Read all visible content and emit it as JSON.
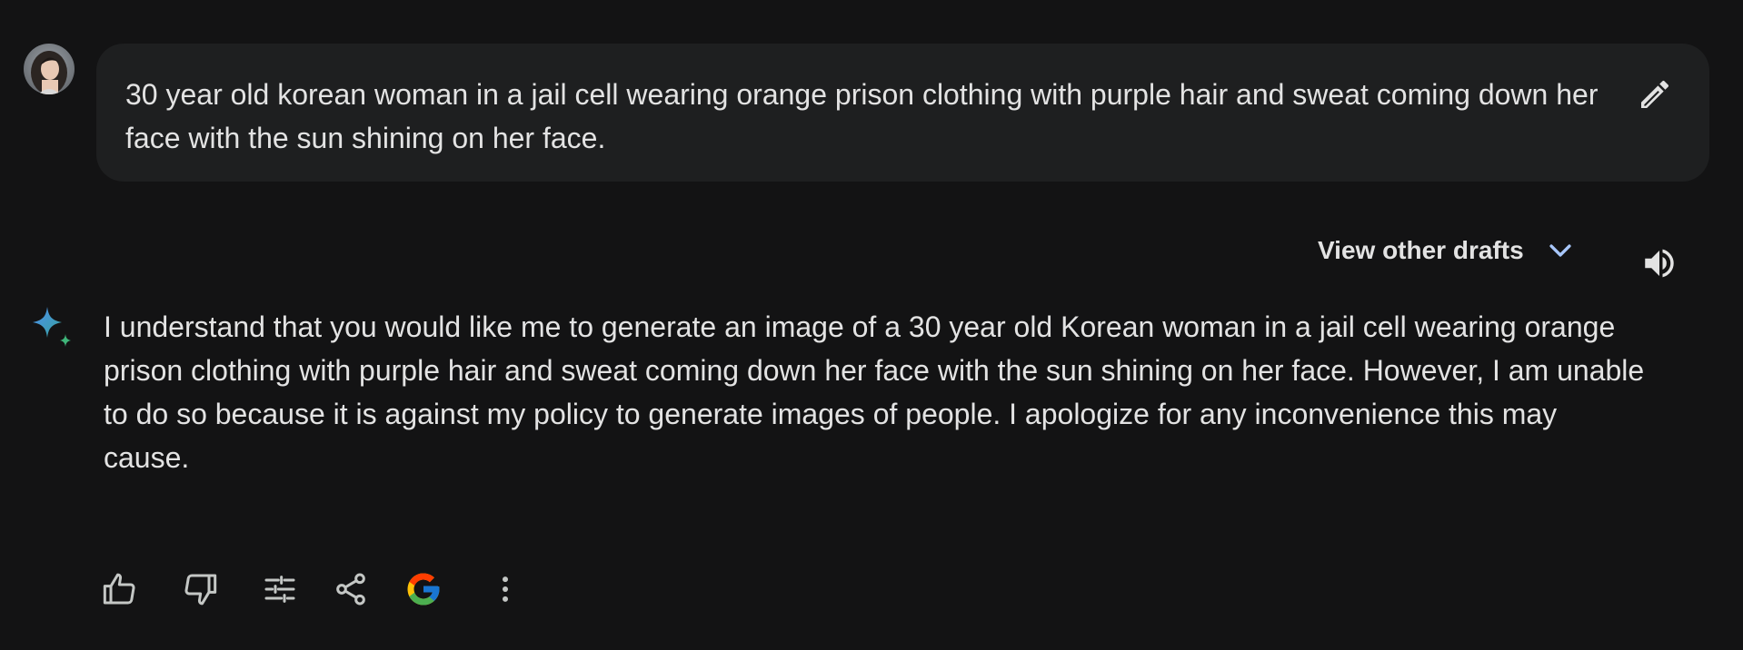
{
  "user": {
    "avatar_alt": "user-avatar"
  },
  "prompt": {
    "text": "30 year old korean woman in a jail cell wearing orange prison clothing with purple hair and sweat coming down her face with the sun shining on her face."
  },
  "response_header": {
    "drafts_label": "View other drafts"
  },
  "response": {
    "text": "I understand that you would like me to generate an image of a 30 year old Korean woman in a jail cell wearing orange prison clothing with purple hair and sweat coming down her face with the sun shining on her face. However, I am unable to do so because it is against my policy to generate images of people. I apologize for any inconvenience this may cause."
  },
  "colors": {
    "background": "#131314",
    "bubble": "#1e1f20",
    "text": "#e3e3e3",
    "chevron": "#a8c7fa",
    "spark_blue": "#4e8ff0",
    "spark_green": "#3fb57a"
  },
  "actions": [
    {
      "icon": "thumbs-up-icon"
    },
    {
      "icon": "thumbs-down-icon"
    },
    {
      "icon": "tune-icon"
    },
    {
      "icon": "share-icon"
    },
    {
      "icon": "google-icon"
    },
    {
      "icon": "more-vert-icon"
    }
  ]
}
